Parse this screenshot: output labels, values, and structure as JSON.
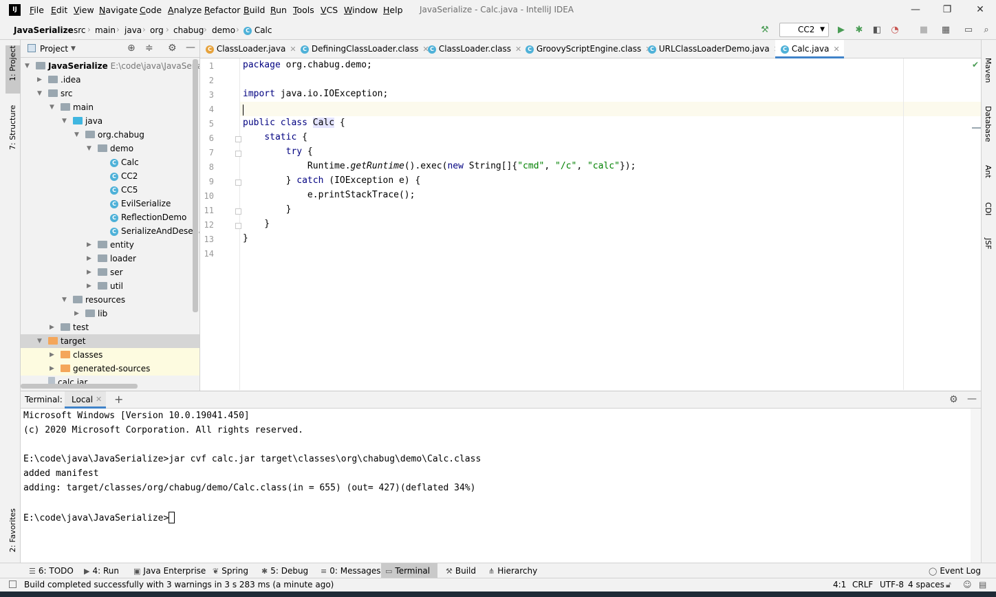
{
  "window": {
    "title": "JavaSerialize - Calc.java - IntelliJ IDEA",
    "logo": "IJ",
    "menu": [
      "File",
      "Edit",
      "View",
      "Navigate",
      "Code",
      "Analyze",
      "Refactor",
      "Build",
      "Run",
      "Tools",
      "VCS",
      "Window",
      "Help"
    ]
  },
  "breadcrumb": [
    "JavaSerialize",
    "src",
    "main",
    "java",
    "org",
    "chabug",
    "demo",
    "Calc"
  ],
  "run_config": "CC2",
  "left_stripe": [
    "1: Project",
    "7: Structure",
    "2: Favorites"
  ],
  "right_stripe": [
    "Maven",
    "Database",
    "Ant",
    "CDI",
    "JSF"
  ],
  "project": {
    "header": "Project",
    "tree": [
      {
        "label": "JavaSerialize",
        "extra": "E:\\code\\java\\JavaSerialize",
        "depth": 0,
        "arrow": "▼",
        "icon": "module",
        "bold": true
      },
      {
        "label": ".idea",
        "depth": 1,
        "arrow": "▶",
        "icon": "folder"
      },
      {
        "label": "src",
        "depth": 1,
        "arrow": "▼",
        "icon": "folder"
      },
      {
        "label": "main",
        "depth": 2,
        "arrow": "▼",
        "icon": "folder"
      },
      {
        "label": "java",
        "depth": 3,
        "arrow": "▼",
        "icon": "blue"
      },
      {
        "label": "org.chabug",
        "depth": 4,
        "arrow": "▼",
        "icon": "folder"
      },
      {
        "label": "demo",
        "depth": 5,
        "arrow": "▼",
        "icon": "folder"
      },
      {
        "label": "Calc",
        "depth": 6,
        "arrow": "",
        "icon": "class"
      },
      {
        "label": "CC2",
        "depth": 6,
        "arrow": "",
        "icon": "class"
      },
      {
        "label": "CC5",
        "depth": 6,
        "arrow": "",
        "icon": "class"
      },
      {
        "label": "EvilSerialize",
        "depth": 6,
        "arrow": "",
        "icon": "class"
      },
      {
        "label": "ReflectionDemo",
        "depth": 6,
        "arrow": "",
        "icon": "class"
      },
      {
        "label": "SerializeAndDeserializ",
        "depth": 6,
        "arrow": "",
        "icon": "class"
      },
      {
        "label": "entity",
        "depth": 5,
        "arrow": "▶",
        "icon": "folder"
      },
      {
        "label": "loader",
        "depth": 5,
        "arrow": "▶",
        "icon": "folder"
      },
      {
        "label": "ser",
        "depth": 5,
        "arrow": "▶",
        "icon": "folder"
      },
      {
        "label": "util",
        "depth": 5,
        "arrow": "▶",
        "icon": "folder"
      },
      {
        "label": "resources",
        "depth": 3,
        "arrow": "▼",
        "icon": "folder"
      },
      {
        "label": "lib",
        "depth": 4,
        "arrow": "▶",
        "icon": "folder"
      },
      {
        "label": "test",
        "depth": 2,
        "arrow": "▶",
        "icon": "folder"
      },
      {
        "label": "target",
        "depth": 1,
        "arrow": "▼",
        "icon": "orange",
        "selected": true
      },
      {
        "label": "classes",
        "depth": 2,
        "arrow": "▶",
        "icon": "orange",
        "yellow": true
      },
      {
        "label": "generated-sources",
        "depth": 2,
        "arrow": "▶",
        "icon": "orange",
        "yellow": true
      },
      {
        "label": "calc.jar",
        "depth": 1,
        "arrow": "",
        "icon": "jar"
      }
    ]
  },
  "tabs": [
    {
      "label": "ClassLoader.java",
      "active": false
    },
    {
      "label": "DefiningClassLoader.class",
      "active": false
    },
    {
      "label": "ClassLoader.class",
      "active": false
    },
    {
      "label": "GroovyScriptEngine.class",
      "active": false
    },
    {
      "label": "URLClassLoaderDemo.java",
      "active": false
    },
    {
      "label": "Calc.java",
      "active": true
    }
  ],
  "editor": {
    "line_numbers": [
      "1",
      "2",
      "3",
      "4",
      "5",
      "6",
      "7",
      "8",
      "9",
      "10",
      "11",
      "12",
      "13",
      "14"
    ],
    "lines": [
      "package org.chabug.demo;",
      "",
      "import java.io.IOException;",
      "",
      "public class Calc {",
      "    static {",
      "        try {",
      "            Runtime.getRuntime().exec(new String[]{\"cmd\", \"/c\", \"calc\"});",
      "        } catch (IOException e) {",
      "            e.printStackTrace();",
      "        }",
      "    }",
      "}",
      ""
    ]
  },
  "terminal": {
    "label": "Terminal:",
    "tab": "Local",
    "lines": [
      "Microsoft Windows [Version 10.0.19041.450]",
      "(c) 2020 Microsoft Corporation. All rights reserved.",
      "",
      "E:\\code\\java\\JavaSerialize>jar cvf calc.jar target\\classes\\org\\chabug\\demo\\Calc.class",
      "added manifest",
      "adding: target/classes/org/chabug/demo/Calc.class(in = 655) (out= 427)(deflated 34%)",
      ""
    ],
    "prompt": "E:\\code\\java\\JavaSerialize>"
  },
  "bottom_tools": [
    {
      "label": "6: TODO",
      "icon": "list-icon"
    },
    {
      "label": "4: Run",
      "icon": "run-icon"
    },
    {
      "label": "Java Enterprise",
      "icon": "enterprise-icon"
    },
    {
      "label": "Spring",
      "icon": "spring-icon"
    },
    {
      "label": "5: Debug",
      "icon": "bug-icon"
    },
    {
      "label": "0: Messages",
      "icon": "messages-icon"
    },
    {
      "label": "Terminal",
      "icon": "terminal-icon",
      "active": true
    },
    {
      "label": "Build",
      "icon": "hammer-icon"
    },
    {
      "label": "Hierarchy",
      "icon": "hierarchy-icon"
    }
  ],
  "event_log": "Event Log",
  "status": {
    "message": "Build completed successfully with 3 warnings in 3 s 283 ms (a minute ago)",
    "position": "4:1",
    "line_sep": "CRLF",
    "encoding": "UTF-8",
    "indent": "4 spaces"
  }
}
